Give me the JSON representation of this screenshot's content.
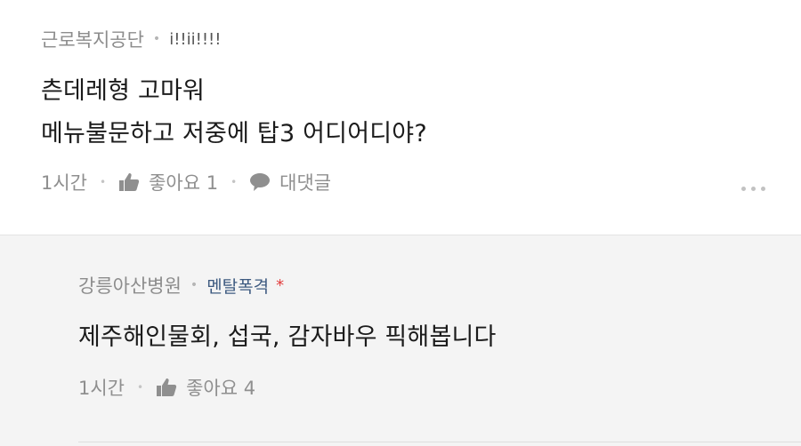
{
  "comment": {
    "author": "근로복지공단",
    "nickname": "i!!ii!!!!",
    "lines": [
      "츤데레형 고마워",
      "메뉴불문하고 저중에 탑3 어디어디야?"
    ],
    "time": "1시간",
    "like_label": "좋아요 1",
    "reply_label": "대댓글"
  },
  "reply": {
    "author": "강릉아산병원",
    "nickname": "멘탈폭격",
    "badge": "*",
    "text": "제주해인물회, 섭국, 감자바우 픽해봅니다",
    "time": "1시간",
    "like_label": "좋아요 4"
  },
  "colors": {
    "accent": "#3d5a80",
    "reply_background": "#f4f4f4",
    "badge": "#e23c3c"
  },
  "icons": [
    "thumbs-up-icon",
    "speech-bubble-icon",
    "more-options-icon"
  ]
}
